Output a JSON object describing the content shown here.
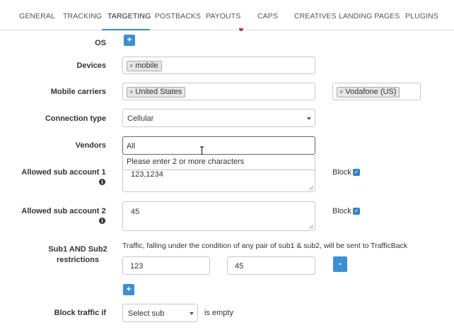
{
  "tabs": [
    {
      "label": "GENERAL"
    },
    {
      "label": "TRACKING"
    },
    {
      "label": "TARGETING"
    },
    {
      "label": "POSTBACKS"
    },
    {
      "label": "PAYOUTS"
    },
    {
      "label": "CAPS"
    },
    {
      "label": "CREATIVES"
    },
    {
      "label": "LANDING PAGES"
    },
    {
      "label": "PLUGINS"
    }
  ],
  "active_tab": "TARGETING",
  "form": {
    "os": {
      "label": "OS",
      "add_button": "+"
    },
    "devices": {
      "label": "Devices",
      "tags": [
        "mobile"
      ],
      "remove_glyph": "×"
    },
    "mobile_carriers": {
      "label": "Mobile carriers",
      "country_tags": [
        "United States"
      ],
      "carrier_tags": [
        "Vodafone (US)"
      ],
      "remove_glyph": "×"
    },
    "connection_type": {
      "label": "Connection type",
      "value": "Cellular"
    },
    "vendors": {
      "label": "Vendors",
      "input_value": "All",
      "hint": "Please enter 2 or more characters"
    },
    "allowed_sub1": {
      "label": "Allowed sub account 1",
      "value": "123,1234",
      "block_label": "Block",
      "block_checked": true
    },
    "allowed_sub2": {
      "label": "Allowed sub account 2",
      "value": "45",
      "block_label": "Block",
      "block_checked": true
    },
    "sub_restrictions": {
      "label": "Sub1 AND Sub2 restrictions",
      "info": "Traffic, falling under the condition of any pair of sub1 & sub2, will be sent to TrafficBack",
      "sub1_value": "123",
      "sub2_value": "45",
      "remove_button": "-",
      "add_button": "+"
    },
    "block_traffic": {
      "label": "Block traffic if",
      "select_value": "Select sub",
      "suffix": "is empty"
    }
  },
  "colors": {
    "accent": "#3a8fd9",
    "tab_underline": "#2f8fd8",
    "checkbox": "#2f7fd0"
  }
}
